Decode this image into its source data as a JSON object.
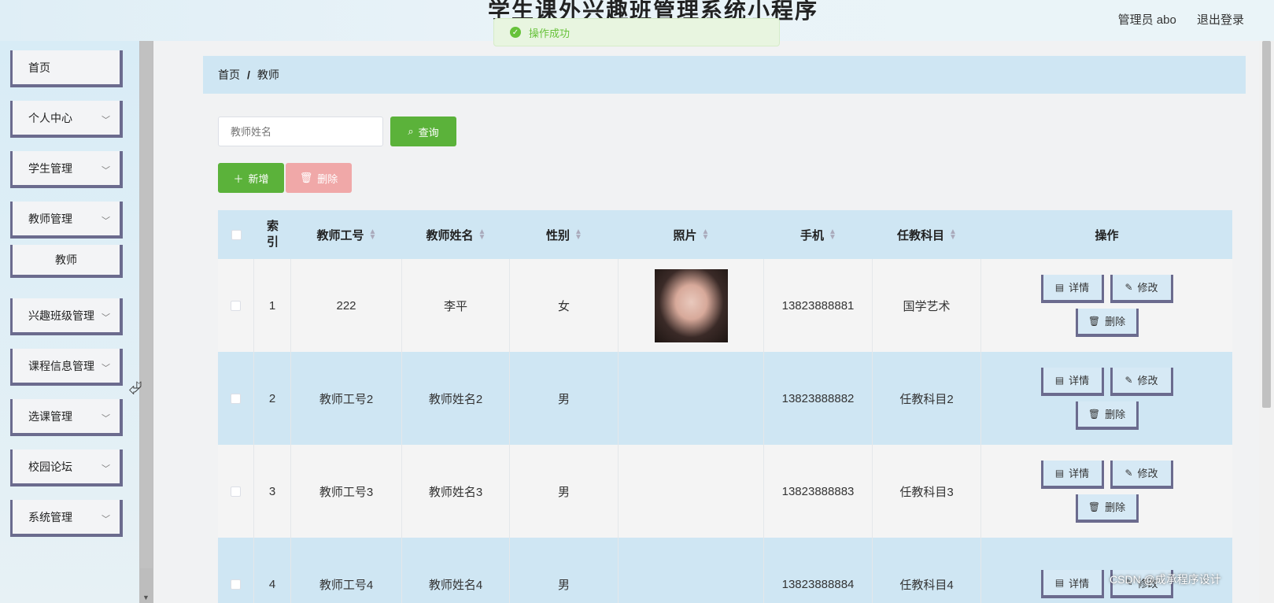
{
  "header": {
    "title": "学生课外兴趣班管理系统小程序",
    "user_label": "管理员 abo",
    "logout_label": "退出登录"
  },
  "toast": {
    "message": "操作成功"
  },
  "sidebar": {
    "items": [
      {
        "label": "首页"
      },
      {
        "label": "个人中心"
      },
      {
        "label": "学生管理"
      },
      {
        "label": "教师管理"
      },
      {
        "label": "教师"
      },
      {
        "label": "兴趣班级管理"
      },
      {
        "label": "课程信息管理"
      },
      {
        "label": "选课管理"
      },
      {
        "label": "校园论坛"
      },
      {
        "label": "系统管理"
      }
    ]
  },
  "breadcrumb": {
    "home": "首页",
    "separator": "/",
    "current": "教师"
  },
  "search": {
    "placeholder": "教师姓名",
    "query_label": "查询"
  },
  "toolbar": {
    "add_label": "新增",
    "delete_label": "删除"
  },
  "table": {
    "headers": {
      "index": "索引",
      "teacher_no": "教师工号",
      "teacher_name": "教师姓名",
      "gender": "性别",
      "photo": "照片",
      "phone": "手机",
      "subject": "任教科目",
      "actions": "操作"
    },
    "actions": {
      "detail": "详情",
      "edit": "修改",
      "delete": "删除"
    },
    "rows": [
      {
        "index": "1",
        "teacher_no": "222",
        "teacher_name": "李平",
        "gender": "女",
        "phone": "13823888881",
        "subject": "国学艺术"
      },
      {
        "index": "2",
        "teacher_no": "教师工号2",
        "teacher_name": "教师姓名2",
        "gender": "男",
        "phone": "13823888882",
        "subject": "任教科目2"
      },
      {
        "index": "3",
        "teacher_no": "教师工号3",
        "teacher_name": "教师姓名3",
        "gender": "男",
        "phone": "13823888883",
        "subject": "任教科目3"
      },
      {
        "index": "4",
        "teacher_no": "教师工号4",
        "teacher_name": "教师姓名4",
        "gender": "男",
        "phone": "13823888884",
        "subject": "任教科目4"
      }
    ]
  },
  "watermark": "CSDN @成承程序设计",
  "colors": {
    "accent_green": "#5bb23a",
    "row_blue": "#cfe6f3",
    "border_purple": "#6b6b8e",
    "danger_light": "#f0a8a8"
  }
}
